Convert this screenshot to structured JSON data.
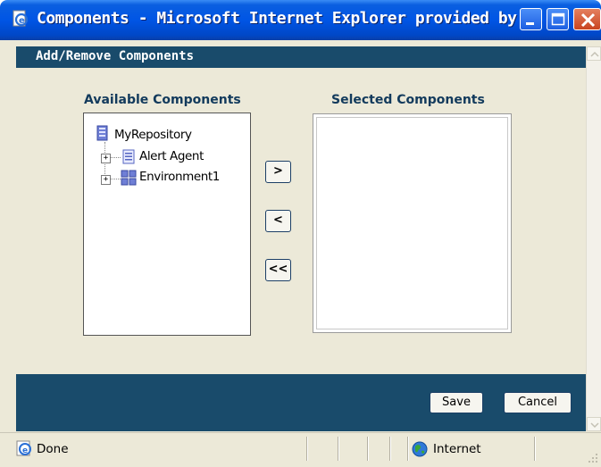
{
  "window": {
    "title": "Components - Microsoft Internet Explorer provided by ...",
    "icon": "ie-page-icon",
    "controls": [
      "minimize-icon",
      "maximize-icon",
      "close-icon"
    ]
  },
  "dialog": {
    "header_title": "Add/Remove Components",
    "available_label": "Available Components",
    "selected_label": "Selected Components",
    "tree": {
      "root": {
        "label": "MyRepository",
        "icon": "repository-icon"
      },
      "children": [
        {
          "label": "Alert Agent",
          "icon": "agent-icon",
          "expander": "+"
        },
        {
          "label": "Environment1",
          "icon": "environment-icon",
          "expander": "+"
        }
      ]
    },
    "selected_items": [],
    "move_buttons": {
      "add": ">",
      "remove": "<",
      "remove_all": "<<"
    },
    "save_label": "Save",
    "cancel_label": "Cancel"
  },
  "statusbar": {
    "status": "Done",
    "zone": "Internet",
    "zone_icon": "globe-icon"
  },
  "colors": {
    "titlebar": "#0055e5",
    "band": "#194b6b",
    "face": "#ece9d8"
  }
}
